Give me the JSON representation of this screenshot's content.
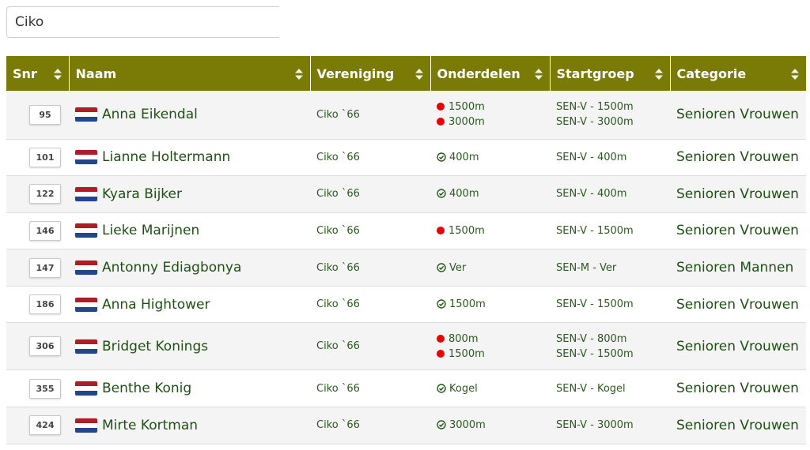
{
  "search": {
    "value": "Ciko"
  },
  "table": {
    "headers": [
      "Snr",
      "Naam",
      "Vereniging",
      "Onderdelen",
      "Startgroep",
      "Categorie"
    ],
    "rows": [
      {
        "snr": "95",
        "name": "Anna Eikendal",
        "club": "Ciko `66",
        "events": [
          {
            "label": "1500m",
            "status": "red-dot"
          },
          {
            "label": "3000m",
            "status": "red-dot"
          }
        ],
        "groups": [
          "SEN-V - 1500m",
          "SEN-V - 3000m"
        ],
        "category": "Senioren Vrouwen"
      },
      {
        "snr": "101",
        "name": "Lianne Holtermann",
        "club": "Ciko `66",
        "events": [
          {
            "label": "400m",
            "status": "check"
          }
        ],
        "groups": [
          "SEN-V - 400m"
        ],
        "category": "Senioren Vrouwen"
      },
      {
        "snr": "122",
        "name": "Kyara Bijker",
        "club": "Ciko `66",
        "events": [
          {
            "label": "400m",
            "status": "check"
          }
        ],
        "groups": [
          "SEN-V - 400m"
        ],
        "category": "Senioren Vrouwen"
      },
      {
        "snr": "146",
        "name": "Lieke Marijnen",
        "club": "Ciko `66",
        "events": [
          {
            "label": "1500m",
            "status": "red-dot"
          }
        ],
        "groups": [
          "SEN-V - 1500m"
        ],
        "category": "Senioren Vrouwen"
      },
      {
        "snr": "147",
        "name": "Antonny Ediagbonya",
        "club": "Ciko `66",
        "events": [
          {
            "label": "Ver",
            "status": "check"
          }
        ],
        "groups": [
          "SEN-M - Ver"
        ],
        "category": "Senioren Mannen"
      },
      {
        "snr": "186",
        "name": "Anna Hightower",
        "club": "Ciko `66",
        "events": [
          {
            "label": "1500m",
            "status": "check"
          }
        ],
        "groups": [
          "SEN-V - 1500m"
        ],
        "category": "Senioren Vrouwen"
      },
      {
        "snr": "306",
        "name": "Bridget Konings",
        "club": "Ciko `66",
        "events": [
          {
            "label": "800m",
            "status": "red-dot"
          },
          {
            "label": "1500m",
            "status": "red-dot"
          }
        ],
        "groups": [
          "SEN-V - 800m",
          "SEN-V - 1500m"
        ],
        "category": "Senioren Vrouwen"
      },
      {
        "snr": "355",
        "name": "Benthe Konig",
        "club": "Ciko `66",
        "events": [
          {
            "label": "Kogel",
            "status": "check"
          }
        ],
        "groups": [
          "SEN-V - Kogel"
        ],
        "category": "Senioren Vrouwen"
      },
      {
        "snr": "424",
        "name": "Mirte Kortman",
        "club": "Ciko `66",
        "events": [
          {
            "label": "3000m",
            "status": "check"
          }
        ],
        "groups": [
          "SEN-V - 3000m"
        ],
        "category": "Senioren Vrouwen"
      }
    ]
  },
  "icons": {
    "sort": "sort-icon",
    "flag": "netherlands-flag-icon",
    "registered": "check-circle-icon",
    "unregistered": "red-dot-icon"
  },
  "colors": {
    "header_bg": "#7a7a06",
    "header_text": "#ffffff",
    "name_text": "#1f5014",
    "dot_red": "#e60000",
    "check_green": "#2a5a1e",
    "flag_red": "#ae1c28",
    "flag_white": "#ffffff",
    "flag_blue": "#21468b"
  }
}
